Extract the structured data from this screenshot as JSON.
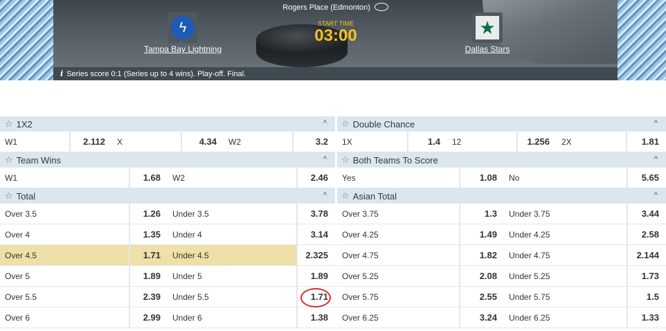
{
  "event": {
    "venue": "Rogers Place (Edmonton)",
    "home_team": "Tampa Bay Lightning",
    "away_team": "Dallas Stars",
    "start_label": "START TIME",
    "start_time": "03:00",
    "info": "Series score 0:1 (Series up to 4 wins). Play-off. Final."
  },
  "markets_left": [
    {
      "title": "1X2",
      "layout": "three",
      "rows": [
        {
          "a_label": "W1",
          "a_odds": "2.112",
          "b_label": "X",
          "b_odds": "4.34",
          "c_label": "W2",
          "c_odds": "3.2"
        }
      ]
    },
    {
      "title": "Team Wins",
      "layout": "two",
      "rows": [
        {
          "a_label": "W1",
          "a_odds": "1.68",
          "b_label": "W2",
          "b_odds": "2.46"
        }
      ]
    },
    {
      "title": "Total",
      "layout": "two",
      "rows": [
        {
          "a_label": "Over 3.5",
          "a_odds": "1.26",
          "b_label": "Under 3.5",
          "b_odds": "3.78"
        },
        {
          "a_label": "Over 4",
          "a_odds": "1.35",
          "b_label": "Under 4",
          "b_odds": "3.14"
        },
        {
          "a_label": "Over 4.5",
          "a_odds": "1.71",
          "b_label": "Under 4.5",
          "b_odds": "2.325",
          "highlighted": true
        },
        {
          "a_label": "Over 5",
          "a_odds": "1.89",
          "b_label": "Under 5",
          "b_odds": "1.89"
        },
        {
          "a_label": "Over 5.5",
          "a_odds": "2.39",
          "b_label": "Under 5.5",
          "b_odds": "1.71",
          "circled": true
        },
        {
          "a_label": "Over 6",
          "a_odds": "2.99",
          "b_label": "Under 6",
          "b_odds": "1.38"
        }
      ]
    }
  ],
  "markets_right": [
    {
      "title": "Double Chance",
      "layout": "three",
      "rows": [
        {
          "a_label": "1X",
          "a_odds": "1.4",
          "b_label": "12",
          "b_odds": "1.256",
          "c_label": "2X",
          "c_odds": "1.81"
        }
      ]
    },
    {
      "title": "Both Teams To Score",
      "layout": "two",
      "rows": [
        {
          "a_label": "Yes",
          "a_odds": "1.08",
          "b_label": "No",
          "b_odds": "5.65"
        }
      ]
    },
    {
      "title": "Asian Total",
      "layout": "two",
      "rows": [
        {
          "a_label": "Over 3.75",
          "a_odds": "1.3",
          "b_label": "Under 3.75",
          "b_odds": "3.44"
        },
        {
          "a_label": "Over 4.25",
          "a_odds": "1.49",
          "b_label": "Under 4.25",
          "b_odds": "2.58"
        },
        {
          "a_label": "Over 4.75",
          "a_odds": "1.82",
          "b_label": "Under 4.75",
          "b_odds": "2.144"
        },
        {
          "a_label": "Over 5.25",
          "a_odds": "2.08",
          "b_label": "Under 5.25",
          "b_odds": "1.73"
        },
        {
          "a_label": "Over 5.75",
          "a_odds": "2.55",
          "b_label": "Under 5.75",
          "b_odds": "1.5"
        },
        {
          "a_label": "Over 6.25",
          "a_odds": "3.24",
          "b_label": "Under 6.25",
          "b_odds": "1.33"
        }
      ]
    }
  ],
  "colors": {
    "header_bg": "#dce6ee",
    "highlight": "#efdfa8",
    "start_time": "#f6c21a",
    "annotation": "#e0262b"
  },
  "icons": {
    "market_favorite": "star-outline-icon",
    "market_collapse": "chevron-up-icon",
    "info": "info-icon",
    "venue": "arena-icon"
  }
}
